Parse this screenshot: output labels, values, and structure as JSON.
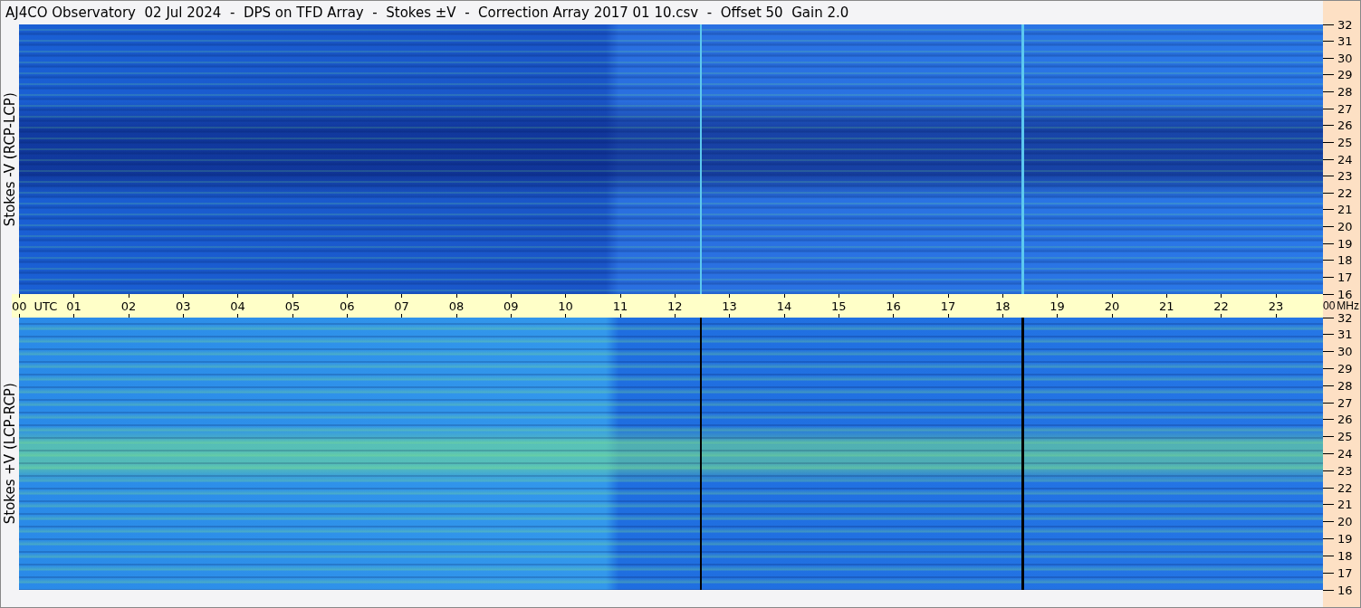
{
  "title": "AJ4CO Observatory  02 Jul 2024  -  DPS on TFD Array  -  Stokes ±V  -  Correction Array 2017 01 10.csv  -  Offset 50  Gain 2.0",
  "panels": [
    {
      "kind": "minus",
      "y_label": "Stokes -V (RCP-LCP)",
      "freq_ticks": [
        "32",
        "31",
        "30",
        "29",
        "28",
        "27",
        "26",
        "25",
        "24",
        "23",
        "22",
        "21",
        "20",
        "19",
        "18",
        "17",
        "16"
      ]
    },
    {
      "kind": "plus",
      "y_label": "Stokes +V (LCP-RCP)",
      "freq_ticks": [
        "32",
        "31",
        "30",
        "29",
        "28",
        "27",
        "26",
        "25",
        "24",
        "23",
        "22",
        "21",
        "20",
        "19",
        "18",
        "17",
        "16"
      ]
    }
  ],
  "time_axis": {
    "first_label": "00",
    "unit": "UTC",
    "hours": [
      "01",
      "02",
      "03",
      "04",
      "05",
      "06",
      "07",
      "08",
      "09",
      "10",
      "11",
      "12",
      "13",
      "14",
      "15",
      "16",
      "17",
      "18",
      "19",
      "20",
      "21",
      "22",
      "23"
    ],
    "last_label": "00",
    "freq_unit": "MHz"
  }
}
